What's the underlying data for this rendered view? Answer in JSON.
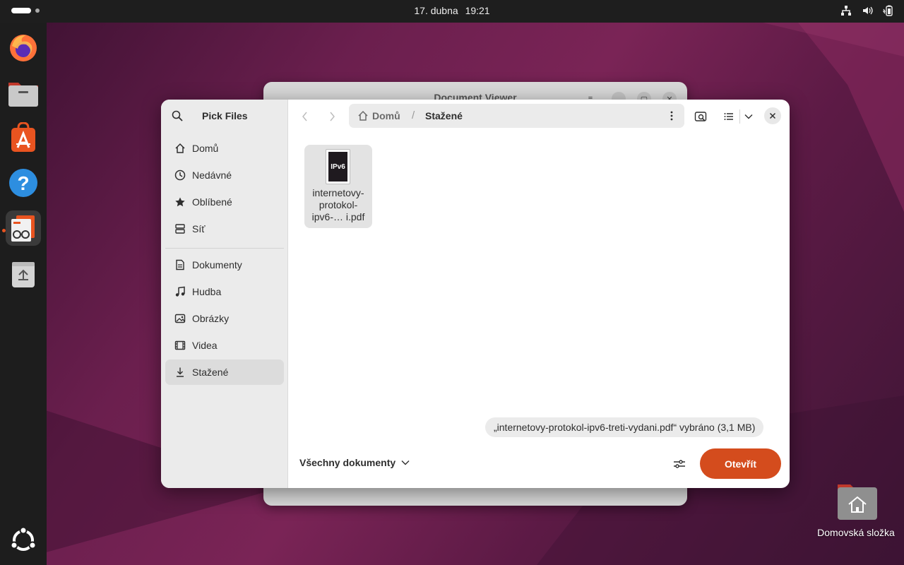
{
  "topbar": {
    "date": "17. dubna",
    "time": "19:21",
    "icons": [
      "network-icon",
      "volume-icon",
      "battery-icon"
    ]
  },
  "dock": {
    "items": [
      {
        "name": "Firefox",
        "icon": "firefox-icon"
      },
      {
        "name": "Files",
        "icon": "files-icon"
      },
      {
        "name": "App Center",
        "icon": "app-center-icon"
      },
      {
        "name": "Help",
        "icon": "help-icon"
      },
      {
        "name": "Document Viewer",
        "icon": "document-viewer-icon",
        "active": true
      },
      {
        "name": "Trash",
        "icon": "trash-icon"
      }
    ],
    "show_apps_icon": "ubuntu-logo-icon"
  },
  "background_window": {
    "title": "Document Viewer"
  },
  "dialog": {
    "title": "Pick Files",
    "sidebar": {
      "places": [
        {
          "label": "Domů",
          "icon": "home-icon"
        },
        {
          "label": "Nedávné",
          "icon": "recent-icon"
        },
        {
          "label": "Oblíbené",
          "icon": "star-icon"
        },
        {
          "label": "Síť",
          "icon": "network-drive-icon"
        }
      ],
      "folders": [
        {
          "label": "Dokumenty",
          "icon": "document-icon"
        },
        {
          "label": "Hudba",
          "icon": "music-icon"
        },
        {
          "label": "Obrázky",
          "icon": "image-icon"
        },
        {
          "label": "Videa",
          "icon": "video-icon"
        },
        {
          "label": "Stažené",
          "icon": "download-icon",
          "selected": true
        }
      ]
    },
    "pathbar": {
      "home": "Domů",
      "separator": "/",
      "current": "Stažené"
    },
    "files": [
      {
        "name": "internetovy-protokol-ipv6-…   i.pdf",
        "thumb_text": "IPv6",
        "selected": true
      }
    ],
    "status": "„internetovy-protokol-ipv6-treti-vydani.pdf“ vybráno  (3,1 MB)",
    "filter": "Všechny dokumenty",
    "open_button": "Otevřít",
    "accent": "#d44c1d"
  },
  "desktop": {
    "home_folder_label": "Domovská složka"
  }
}
